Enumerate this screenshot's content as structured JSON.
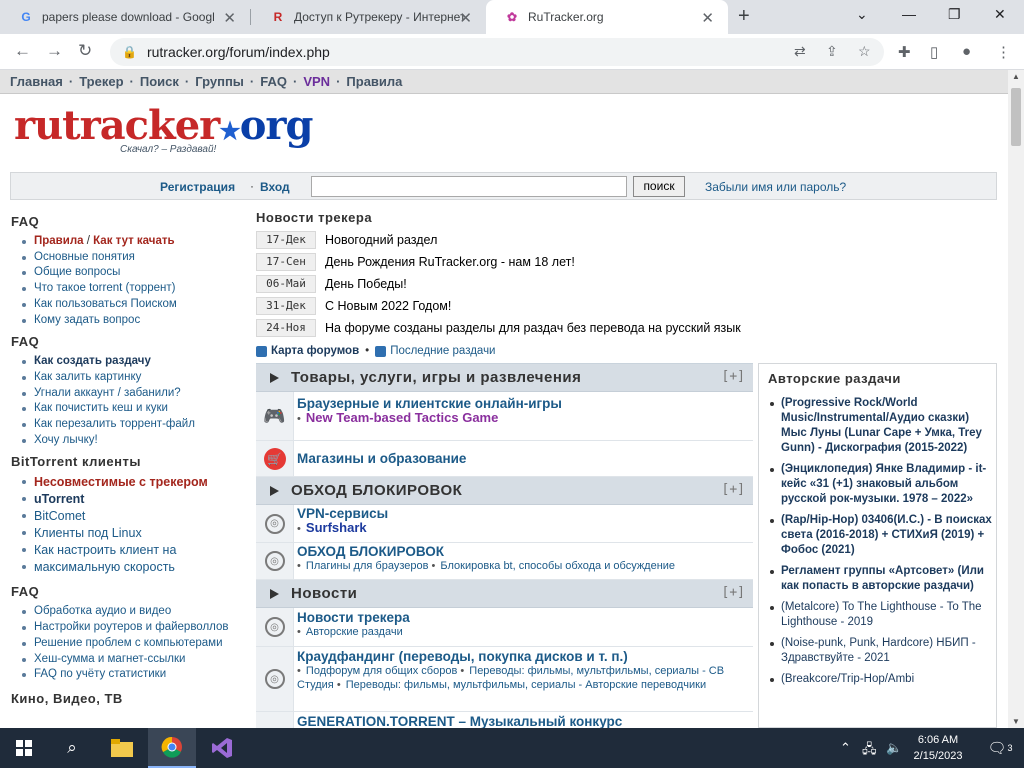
{
  "browser": {
    "tabs": [
      {
        "title": "papers please download - Googl",
        "favicon": "G"
      },
      {
        "title": "Доступ к Рутрекеру - Интернет",
        "favicon": "R"
      },
      {
        "title": "RuTracker.org",
        "favicon": "✿"
      }
    ],
    "url": "rutracker.org/forum/index.php"
  },
  "site": {
    "menu": [
      "Главная",
      "Трекер",
      "Поиск",
      "Группы",
      "FAQ",
      "VPN",
      "Правила"
    ],
    "logo_text": "rutracker",
    "logo_org": "org",
    "tagline": "Скачал? – Раздавай!",
    "login": {
      "register": "Регистрация",
      "enter": "Вход",
      "search_button": "поиск",
      "forgot": "Забыли имя или пароль?"
    },
    "left": {
      "faq1_title": "FAQ",
      "faq1": {
        "rules": "Правила",
        "slash": "/",
        "how": "Как тут качать",
        "items": [
          "Основные понятия",
          "Общие вопросы",
          "Что такое torrent (торрент)",
          "Как пользоваться Поиском",
          "Кому задать вопрос"
        ]
      },
      "faq2_title": "FAQ",
      "faq2": [
        "Как создать раздачу",
        "Как залить картинку",
        "Угнали аккаунт / забанили?",
        "Как почистить кеш и куки",
        "Как перезалить торрент-файл",
        "Хочу лычку!"
      ],
      "bt_title": "BitTorrent клиенты",
      "bt": [
        "Несовместимые с трекером",
        "uTorrent",
        "BitComet",
        "Клиенты под Linux",
        "Как настроить клиент на",
        "максимальную скорость"
      ],
      "faq3_title": "FAQ",
      "faq3": [
        "Обработка аудио и видео",
        "Настройки роутеров и файерволлов",
        "Решение проблем с компьютерами",
        "Хеш-сумма и магнет-ссылки",
        "FAQ по учёту статистики"
      ],
      "kino_title": "Кино, Видео, ТВ"
    },
    "news": {
      "title": "Новости трекера",
      "items": [
        {
          "date": "17-Дек",
          "text": "Новогодний раздел"
        },
        {
          "date": "17-Сен",
          "text": "День Рождения RuTracker.org - нам 18 лет!"
        },
        {
          "date": "06-Май",
          "text": "День Победы!"
        },
        {
          "date": "31-Дек",
          "text": "С Новым 2022 Годом!"
        },
        {
          "date": "24-Ноя",
          "text": "На форуме созданы разделы для раздач без перевода на русский язык"
        }
      ]
    },
    "forum_links": {
      "map": "Карта форумов",
      "dot": "•",
      "latest": "Последние раздачи"
    },
    "forum": {
      "plus": "[+]",
      "bullet": "•",
      "cat1": "Товары, услуги, игры и развлечения",
      "f1_title": "Браузерные и клиентские онлайн-игры",
      "f1_sub": "New Team-based Tactics Game",
      "f2_title": "Магазины и образование",
      "cat2": "ОБХОД БЛОКИРОВОК",
      "f3_title": "VPN-сервисы",
      "f3_sub": "Surfshark",
      "f4_title": "ОБХОД БЛОКИРОВОК",
      "f4_sub1": "Плагины для браузеров",
      "f4_sub2": "Блокировка bt, способы обхода и обсуждение",
      "cat3": "Новости",
      "f5_title": "Новости трекера",
      "f5_sub": "Авторские раздачи",
      "f6_title": "Краудфандинг (переводы, покупка дисков и т. п.)",
      "f6_sub1": "Подфорум для общих сборов",
      "f6_sub2": "Переводы: фильмы, мультфильмы, сериалы - СВ Студия",
      "f6_sub3": "Переводы: фильмы, мультфильмы, сериалы - Авторские переводчики",
      "f7_title": "GENERATION.TORRENT – Музыкальный конкурс"
    },
    "author": {
      "title": "Авторские раздачи",
      "items": [
        "(Progressive Rock/World Music/Instrumental/Аудио сказки) Мыс Луны (Lunar Cape + Умка, Trey Gunn) - Дискография (2015-2022)",
        "(Энциклопедия) Янке Владимир - it-кейс «31 (+1) знаковый альбом русской рок-музыки. 1978 – 2022»",
        "(Rap/Hip-Hop) 03406(И.С.) - В поисках света (2016-2018) + СТИХиЯ (2019) + Фобос (2021)",
        "Регламент группы «Артсовет» (Или как попасть в авторские раздачи)",
        "(Metalcore) To The Lighthouse - To The Lighthouse - 2019",
        "(Noise-punk, Punk, Hardcore) НБИП - Здравствуйте - 2021",
        "(Breakcore/Trip-Hop/Ambi"
      ]
    }
  },
  "taskbar": {
    "time": "6:06 AM",
    "date": "2/15/2023",
    "notif": "3"
  }
}
